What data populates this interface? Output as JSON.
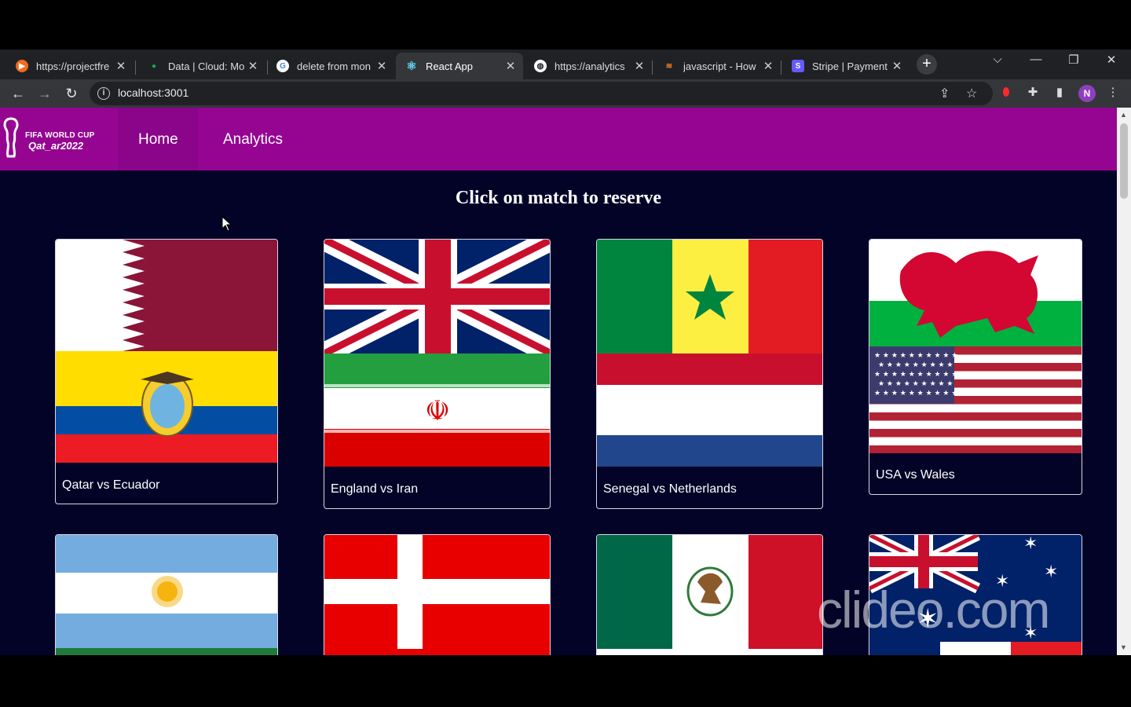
{
  "browser": {
    "tabs": [
      {
        "title": "https://projectfre",
        "favicon_color": "#f26b1d",
        "active": false
      },
      {
        "title": "Data | Cloud: Mo",
        "favicon_color": "#0f9d58",
        "active": false
      },
      {
        "title": "delete from mon",
        "favicon_color": "#4285f4",
        "active": false
      },
      {
        "title": "React App",
        "favicon_color": "#61dafb",
        "active": true
      },
      {
        "title": "https://analytics",
        "favicon_color": "#ffffff",
        "active": false
      },
      {
        "title": "javascript - How",
        "favicon_color": "#f48024",
        "active": false
      },
      {
        "title": "Stripe | Payment",
        "favicon_color": "#635bff",
        "active": false
      }
    ],
    "url": "localhost:3001",
    "profile_initial": "N"
  },
  "app": {
    "logo_line1": "FIFA WORLD CUP",
    "logo_line2": "Qat_ar2022",
    "nav": {
      "home": "Home",
      "analytics": "Analytics"
    },
    "heading": "Click on match to reserve",
    "matches": [
      {
        "label": "Qatar vs Ecuador"
      },
      {
        "label": "England vs Iran"
      },
      {
        "label": "Senegal vs Netherlands"
      },
      {
        "label": "USA vs Wales"
      },
      {
        "label": ""
      },
      {
        "label": ""
      },
      {
        "label": ""
      },
      {
        "label": ""
      }
    ]
  },
  "watermark": "clideo.com",
  "colors": {
    "navbar": "#960592",
    "page_bg": "#030227"
  }
}
